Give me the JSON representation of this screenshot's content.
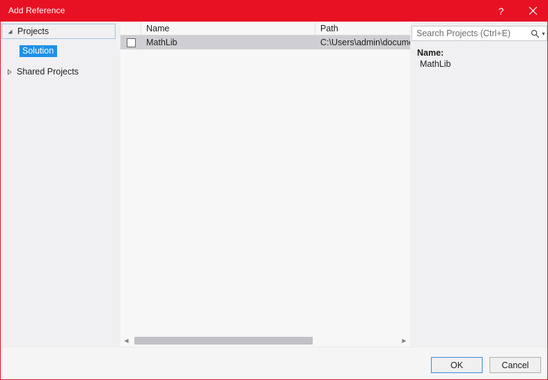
{
  "window": {
    "title": "Add Reference",
    "help_label": "?",
    "close_label": "×",
    "accent_red": "#e81123",
    "selection_blue": "#1e90e8",
    "row_selected_gray": "#cfcfd3"
  },
  "tree": {
    "nodes": [
      {
        "label": "Projects",
        "twisty": "expanded-triangle-icon",
        "focused": true
      },
      {
        "label": "Solution",
        "twisty": "none",
        "selected": true
      },
      {
        "label": "Shared Projects",
        "twisty": "collapsed-triangle-icon",
        "focused": false
      }
    ]
  },
  "list": {
    "columns": [
      "",
      "Name",
      "Path"
    ],
    "rows": [
      {
        "checked": false,
        "name": "MathLib",
        "path": "C:\\Users\\admin\\documen",
        "selected": true
      }
    ]
  },
  "scrollbar": {
    "left_arrow": "◀",
    "right_arrow": "▶"
  },
  "search": {
    "placeholder": "Search Projects (Ctrl+E)",
    "value": "",
    "icon": "magnifier-icon",
    "caret": "▾"
  },
  "detail": {
    "key": "Name:",
    "value": "MathLib"
  },
  "footer": {
    "ok_label": "OK",
    "cancel_label": "Cancel"
  }
}
